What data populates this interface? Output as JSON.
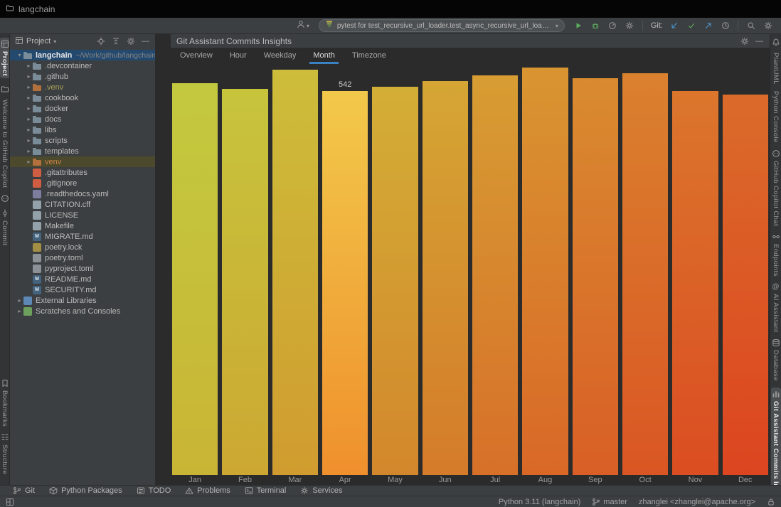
{
  "titlebar": {
    "title": "langchain"
  },
  "toolbar": {
    "run_config": "pytest for test_recursive_url_loader.test_async_recursive_url_loader_metadata",
    "git_label": "Git:"
  },
  "left_strip": {
    "items": [
      {
        "label": "Project",
        "icon": "project-tool-icon",
        "active": true
      },
      {
        "icon": "folder-tool-icon"
      },
      {
        "label": "Welcome to GitHub Copilot"
      },
      {
        "icon": "copilot-icon"
      },
      {
        "label": "Commit",
        "icon": "commit-tool-icon"
      }
    ],
    "bottom_items": [
      {
        "label": "Bookmarks",
        "icon": "bookmark-icon"
      },
      {
        "label": "Structure",
        "icon": "structure-icon"
      }
    ]
  },
  "project_panel": {
    "header_title": "Project",
    "tree": [
      {
        "label": "langchain",
        "sub": "~/Work/github/langchain",
        "depth": 0,
        "arrow": "open",
        "icon": "folder",
        "highlight": "blue",
        "bold": true
      },
      {
        "label": ".devcontainer",
        "depth": 1,
        "arrow": "closed",
        "icon": "folder"
      },
      {
        "label": ".github",
        "depth": 1,
        "arrow": "closed",
        "icon": "folder"
      },
      {
        "label": ".venv",
        "depth": 1,
        "arrow": "closed",
        "icon": "folder-excluded",
        "text_color": "excluded"
      },
      {
        "label": "cookbook",
        "depth": 1,
        "arrow": "closed",
        "icon": "folder"
      },
      {
        "label": "docker",
        "depth": 1,
        "arrow": "closed",
        "icon": "folder"
      },
      {
        "label": "docs",
        "depth": 1,
        "arrow": "closed",
        "icon": "folder"
      },
      {
        "label": "libs",
        "depth": 1,
        "arrow": "closed",
        "icon": "folder"
      },
      {
        "label": "scripts",
        "depth": 1,
        "arrow": "closed",
        "icon": "folder"
      },
      {
        "label": "templates",
        "depth": 1,
        "arrow": "closed",
        "icon": "folder"
      },
      {
        "label": "venv",
        "depth": 1,
        "arrow": "closed",
        "icon": "folder-excluded",
        "highlight": "olive",
        "text_color": "venv"
      },
      {
        "label": ".gitattributes",
        "depth": 1,
        "icon": "git-file"
      },
      {
        "label": ".gitignore",
        "depth": 1,
        "icon": "git-file"
      },
      {
        "label": ".readthedocs.yaml",
        "depth": 1,
        "icon": "yaml-file"
      },
      {
        "label": "CITATION.cff",
        "depth": 1,
        "icon": "text-file"
      },
      {
        "label": "LICENSE",
        "depth": 1,
        "icon": "text-file"
      },
      {
        "label": "Makefile",
        "depth": 1,
        "icon": "text-file"
      },
      {
        "label": "MIGRATE.md",
        "depth": 1,
        "icon": "md-file"
      },
      {
        "label": "poetry.lock",
        "depth": 1,
        "icon": "lock-file"
      },
      {
        "label": "poetry.toml",
        "depth": 1,
        "icon": "toml-file"
      },
      {
        "label": "pyproject.toml",
        "depth": 1,
        "icon": "toml-file"
      },
      {
        "label": "README.md",
        "depth": 1,
        "icon": "md-file"
      },
      {
        "label": "SECURITY.md",
        "depth": 1,
        "icon": "md-file"
      },
      {
        "label": "External Libraries",
        "depth": 0,
        "arrow": "closed",
        "icon": "libraries"
      },
      {
        "label": "Scratches and Consoles",
        "depth": 0,
        "arrow": "closed",
        "icon": "scratches"
      }
    ]
  },
  "main": {
    "title": "Git Assistant Commits Insights",
    "tabs": [
      {
        "label": "Overview"
      },
      {
        "label": "Hour"
      },
      {
        "label": "Weekday"
      },
      {
        "label": "Month",
        "active": true
      },
      {
        "label": "Timezone"
      }
    ]
  },
  "chart_data": {
    "type": "bar",
    "title": "",
    "categories": [
      "Jan",
      "Feb",
      "Mar",
      "Apr",
      "May",
      "Jun",
      "Jul",
      "Aug",
      "Sep",
      "Oct",
      "Nov",
      "Dec"
    ],
    "values": [
      553,
      545,
      572,
      542,
      548,
      556,
      564,
      575,
      560,
      567,
      542,
      537
    ],
    "labeled_value": {
      "category": "Apr",
      "text": "542"
    },
    "xlabel": "",
    "ylabel": "",
    "ylim": [
      0,
      580
    ],
    "grid": false,
    "legend": false,
    "bar_gradients": [
      [
        "#c3c93e",
        "#c9b535"
      ],
      [
        "#c7c43c",
        "#cca832"
      ],
      [
        "#cdbd3a",
        "#d09c2f"
      ],
      [
        "#f2c94a",
        "#ef902d"
      ],
      [
        "#d3ae36",
        "#d3872c"
      ],
      [
        "#d5a634",
        "#d57b2a"
      ],
      [
        "#d79d33",
        "#d77029"
      ],
      [
        "#d99531",
        "#d96827"
      ],
      [
        "#d98b30",
        "#d95f26"
      ],
      [
        "#da812e",
        "#da5624"
      ],
      [
        "#db762c",
        "#db4d22"
      ],
      [
        "#db6b2a",
        "#dc4520"
      ]
    ]
  },
  "right_strip": {
    "items": [
      {
        "icon": "bell-icon"
      },
      {
        "label": "PlantUML"
      },
      {
        "label": "Python Console"
      },
      {
        "label": "GitHub Copilot Chat",
        "icon": "copilot-icon"
      },
      {
        "label": "Endpoints",
        "icon": "endpoints-icon"
      },
      {
        "label": "AI Assistant",
        "icon": "at-icon"
      },
      {
        "label": "Database",
        "icon": "database-icon"
      },
      {
        "label": "Git Assistant Commits Insights",
        "icon": "chart-icon",
        "active": true
      }
    ]
  },
  "bottom_bar": {
    "items": [
      {
        "label": "Git",
        "icon": "git-branch-icon"
      },
      {
        "label": "Python Packages",
        "icon": "python-packages-icon"
      },
      {
        "label": "TODO",
        "icon": "todo-icon"
      },
      {
        "label": "Problems",
        "icon": "problems-icon"
      },
      {
        "label": "Terminal",
        "icon": "terminal-icon"
      },
      {
        "label": "Services",
        "icon": "services-icon"
      }
    ]
  },
  "status_bar": {
    "items": [
      {
        "label": "Python 3.11 (langchain)",
        "name": "python-interpreter-widget"
      },
      {
        "label": "master",
        "icon": "git-branch-icon",
        "name": "git-branch-widget"
      },
      {
        "label": "zhanglei <zhanglei@apache.org>",
        "name": "git-user-widget"
      },
      {
        "icon": "lock-icon",
        "name": "lock-widget"
      }
    ]
  },
  "colors": {
    "accent_tab": "#3b82c4",
    "selection_blue": "#24496e",
    "selection_olive": "#4c492c",
    "run_green": "#5cad5f",
    "git_blue": "#4a9bd6",
    "excluded_text": "#a7a05a",
    "venv_text": "#d08546"
  }
}
